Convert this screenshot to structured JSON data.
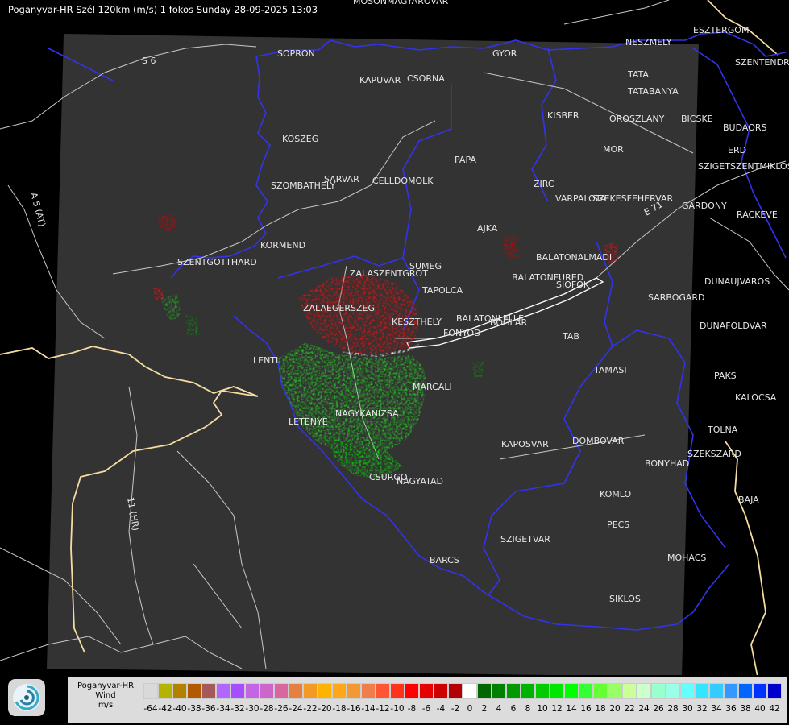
{
  "title": "Poganyvar-HR Szél 120km (m/s) 1 fokos Sunday 28-09-2025 13:03",
  "legend": {
    "line1": "Poganyvar-HR",
    "line2": "Wind",
    "unit": "m/s",
    "ticks": [
      "-64",
      "-42",
      "-40",
      "-38",
      "-36",
      "-34",
      "-32",
      "-30",
      "-28",
      "-26",
      "-24",
      "-22",
      "-20",
      "-18",
      "-16",
      "-14",
      "-12",
      "-10",
      "-8",
      "-6",
      "-4",
      "-2",
      "0",
      "2",
      "4",
      "6",
      "8",
      "10",
      "12",
      "14",
      "16",
      "18",
      "20",
      "22",
      "24",
      "26",
      "28",
      "30",
      "32",
      "34",
      "36",
      "38",
      "40",
      "42"
    ],
    "colors": [
      "#d9d9d9",
      "#b3b300",
      "#b38000",
      "#b35900",
      "#a65959",
      "#b366ff",
      "#a64dff",
      "#c266e6",
      "#cc66cc",
      "#d9669e",
      "#e68040",
      "#f29926",
      "#ffb300",
      "#ffa619",
      "#f29933",
      "#ee7f4d",
      "#ff5533",
      "#ff3319",
      "#ff0000",
      "#e60000",
      "#cc0000",
      "#b30000",
      "#ffffff",
      "#006600",
      "#008000",
      "#009900",
      "#00b300",
      "#00cc00",
      "#00e600",
      "#00ff00",
      "#33ff33",
      "#66ff33",
      "#99ff66",
      "#ccff99",
      "#ccffcc",
      "#99ffcc",
      "#99ffe6",
      "#66ffff",
      "#33e6ff",
      "#33ccff",
      "#3399ff",
      "#0066ff",
      "#0033ff",
      "#0000cc"
    ]
  },
  "roads": [
    "S 6",
    "A 5 (AT)",
    "11 (HR)",
    "E 71"
  ],
  "cities": [
    "MOSONMAGYAROVAR",
    "SOPRON",
    "GYOR",
    "KAPUVAR",
    "CSORNA",
    "NESZMELY",
    "ESZTERGOM",
    "TATA",
    "TATABANYA",
    "SZENTENDRE",
    "KISBER",
    "OROSZLANY",
    "BICSKE",
    "BUDAORS",
    "KOSZEG",
    "MOR",
    "ERD",
    "PAPA",
    "SZIGETSZENTMIKLOS",
    "SZOMBATHELY",
    "SARVAR",
    "CELLDOMOLK",
    "ZIRC",
    "VARPALOTA",
    "SZEKESFEHERVAR",
    "GARDONY",
    "RACKEVE",
    "AJKA",
    "BALATONALMADI",
    "KORMEND",
    "SZENTGOTTHARD",
    "SUMEG",
    "ZALASZENTGROT",
    "TAPOLCA",
    "BALATONFURED",
    "SIOFOK",
    "SARBOGARD",
    "DUNAUJVAROS",
    "ZALAEGERSZEG",
    "KESZTHELY",
    "BALATONLELLE",
    "FONYOD",
    "BOGLAR",
    "DUNAFOLDVAR",
    "LENTI",
    "TAB",
    "TAMASI",
    "MARCALI",
    "PAKS",
    "KALOCSA",
    "LETENYE",
    "NAGYKANIZSA",
    "KAPOSVAR",
    "DOMBOVAR",
    "TOLNA",
    "SZEKSZARD",
    "CSURGO",
    "NAGYATAD",
    "BONYHAD",
    "KOMLO",
    "BAJA",
    "PECS",
    "SZIGETVAR",
    "MOHACS",
    "BARCS",
    "SIKLOS"
  ]
}
